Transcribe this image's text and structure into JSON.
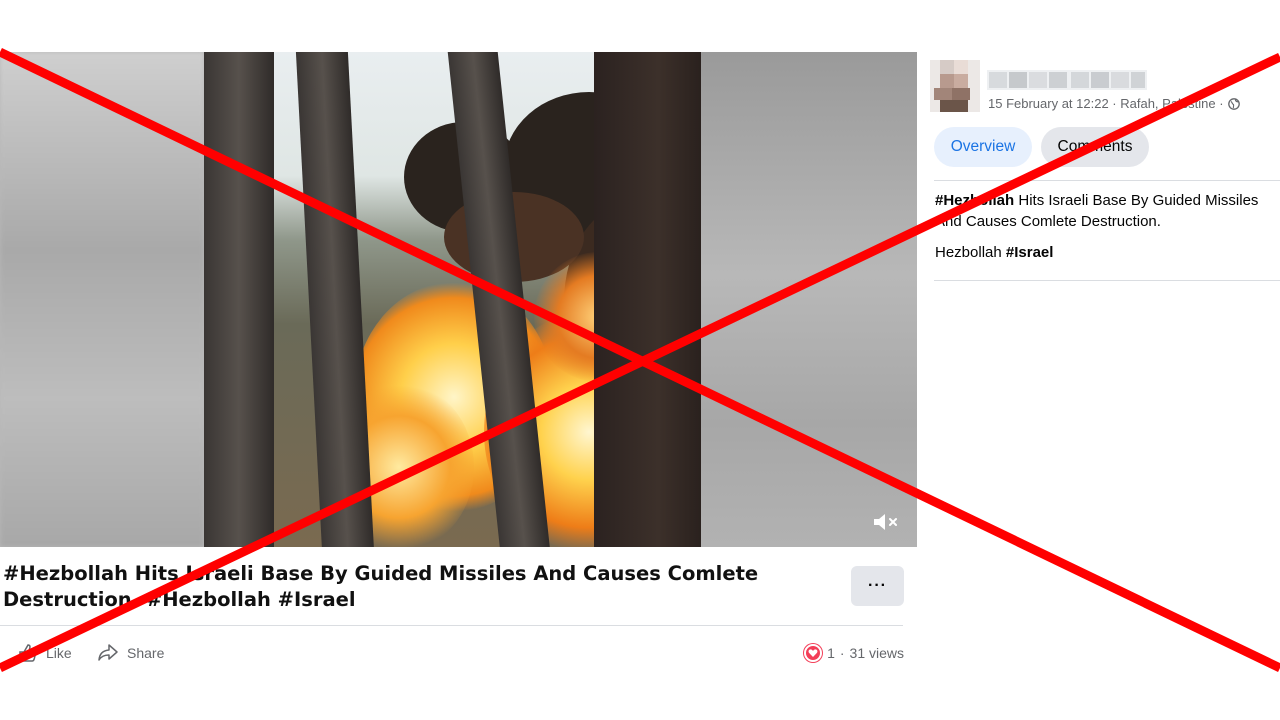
{
  "video": {
    "caption": "#Hezbollah Hits Israeli Base By Guided Missiles And Causes Comlete Destruction. #Hezbollah #Israel",
    "more_label": "···"
  },
  "actions": {
    "like_label": "Like",
    "share_label": "Share",
    "reaction_count": "1",
    "separator": "·",
    "views": "31 views"
  },
  "post": {
    "meta": "15 February at 12:22 · Rafah, Palestine ·",
    "tabs": [
      {
        "label": "Overview",
        "active": true
      },
      {
        "label": "Comments",
        "active": false
      }
    ],
    "text_hashtag": "#Hezbollah",
    "text_rest": " Hits Israeli Base By Guided Missiles And Causes Comlete Destruction.",
    "line2_plain": "Hezbollah ",
    "line2_hashtag": "#Israel"
  },
  "overlay": {
    "cross_color": "#ff0000"
  },
  "icons": [
    "mute-icon",
    "more-icon",
    "like-icon",
    "share-icon",
    "heart-reaction-icon",
    "globe-icon"
  ],
  "colors": {
    "accent": "#1b74e4",
    "tab_active_bg": "#e7f0fd",
    "button_bg": "#e4e6eb",
    "muted_text": "#65676b",
    "heart": "#f33e58"
  }
}
